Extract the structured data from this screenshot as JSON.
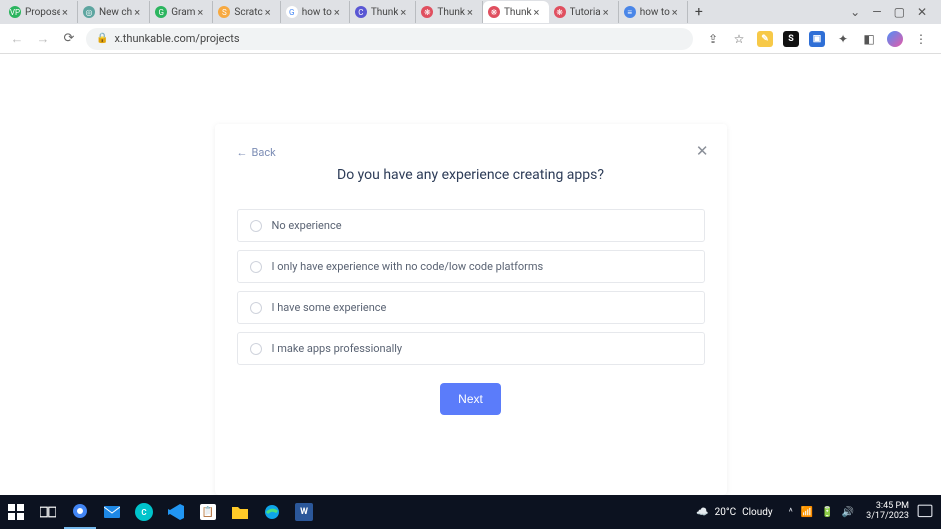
{
  "browser": {
    "tabs": [
      {
        "title": "Propose",
        "favicon_bg": "#2cb55f",
        "favicon_text": "VP"
      },
      {
        "title": "New ch",
        "favicon_bg": "#5da5a0",
        "favicon_text": "◎"
      },
      {
        "title": "Gram",
        "favicon_bg": "#2cb55f",
        "favicon_text": "G"
      },
      {
        "title": "Scratc",
        "favicon_bg": "#f7a940",
        "favicon_text": "S"
      },
      {
        "title": "how to",
        "favicon_bg": "#ffffff",
        "favicon_text": "G",
        "favicon_fg": "#4285f4"
      },
      {
        "title": "Thunk",
        "favicon_bg": "#5a57d4",
        "favicon_text": "C"
      },
      {
        "title": "Thunk",
        "favicon_bg": "#e04f5f",
        "favicon_text": "❋"
      },
      {
        "title": "Thunk",
        "favicon_bg": "#e04f5f",
        "favicon_text": "❋",
        "active": true
      },
      {
        "title": "Tutoria",
        "favicon_bg": "#e04f5f",
        "favicon_text": "❋"
      },
      {
        "title": "how to",
        "favicon_bg": "#4a86e8",
        "favicon_text": "≡"
      }
    ],
    "url": "x.thunkable.com/projects"
  },
  "onboarding": {
    "back_label": "Back",
    "title": "Do you have any experience creating apps?",
    "options": [
      "No experience",
      "I only have experience with no code/low code platforms",
      "I have some experience",
      "I make apps professionally"
    ],
    "next_label": "Next"
  },
  "taskbar": {
    "weather_temp": "20°C",
    "weather_desc": "Cloudy",
    "time": "3:45 PM",
    "date": "3/17/2023"
  }
}
